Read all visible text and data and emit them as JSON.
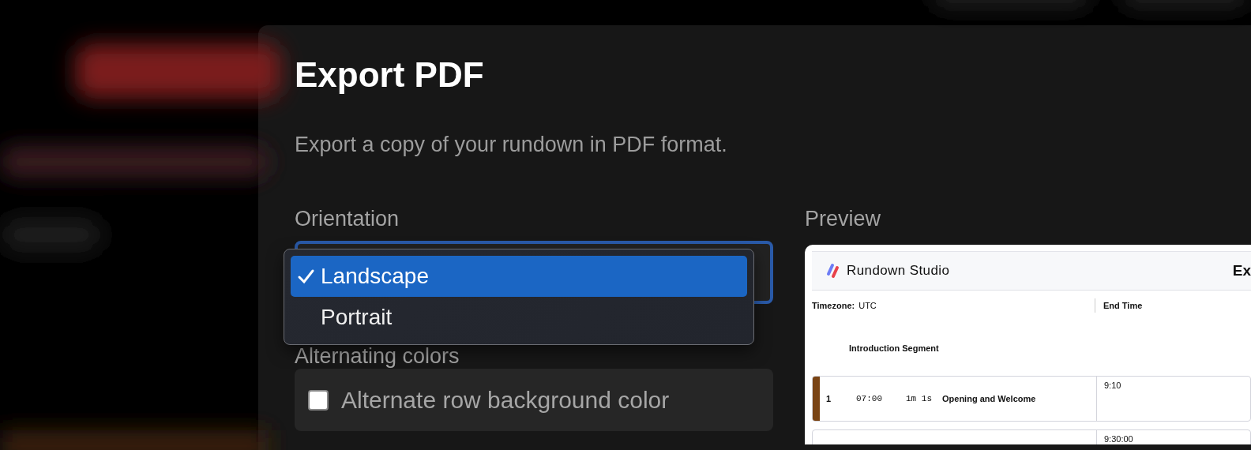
{
  "dialog": {
    "title": "Export PDF",
    "description": "Export a copy of your rundown in PDF format.",
    "orientation": {
      "label": "Orientation",
      "options": [
        {
          "label": "Landscape",
          "selected": true
        },
        {
          "label": "Portrait",
          "selected": false
        }
      ]
    },
    "alternating_colors": {
      "label": "Alternating colors",
      "option": {
        "label": "Alternate row background color",
        "checked": false
      }
    },
    "preview": {
      "label": "Preview",
      "document": {
        "brand": "Rundown Studio",
        "title": "Ex",
        "timezone_label": "Timezone:",
        "timezone": "UTC",
        "end_time_label": "End Time",
        "segment": "Introduction Segment",
        "rows": [
          {
            "number": "1",
            "start": "07:00",
            "duration": "1m 1s",
            "title": "Opening and Welcome",
            "end_time": "9:10",
            "color": "#7a4414"
          },
          {
            "end_time": "9:30:00"
          }
        ]
      }
    }
  }
}
